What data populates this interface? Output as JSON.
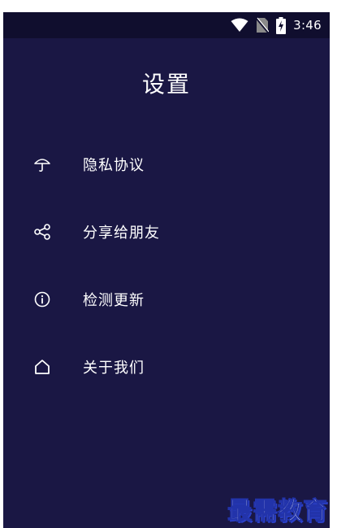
{
  "status_bar": {
    "time": "3:46",
    "icons": [
      "wifi-icon",
      "no-sim-icon",
      "battery-charging-icon"
    ]
  },
  "header": {
    "title": "设置"
  },
  "menu": {
    "items": [
      {
        "label": "隐私协议",
        "icon": "umbrella-icon"
      },
      {
        "label": "分享给朋友",
        "icon": "share-icon"
      },
      {
        "label": "检测更新",
        "icon": "info-icon"
      },
      {
        "label": "关于我们",
        "icon": "home-icon"
      }
    ]
  },
  "watermark": {
    "text": "最需教育"
  },
  "colors": {
    "background": "#1a1744",
    "status_bar": "#100e2e",
    "text": "#ffffff"
  }
}
